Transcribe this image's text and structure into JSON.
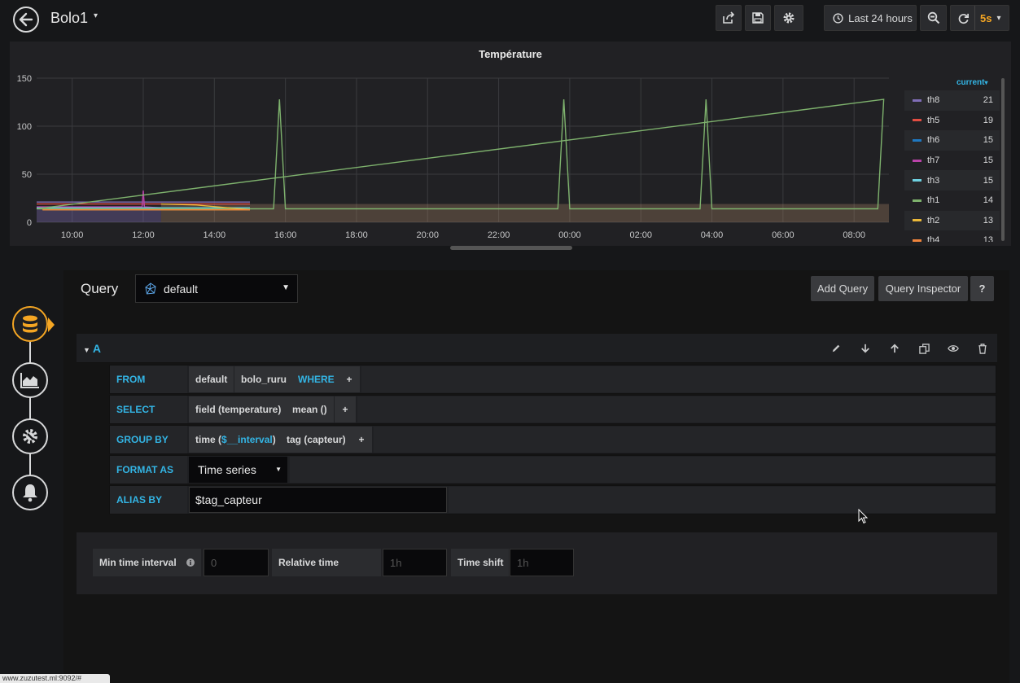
{
  "header": {
    "dashboard_title": "Bolo1",
    "time_range": "Last 24 hours",
    "refresh_interval": "5s"
  },
  "panel": {
    "title": "Température",
    "legend_header": "current",
    "legend": [
      {
        "name": "th8",
        "value": "21",
        "color": "#806eb7"
      },
      {
        "name": "th5",
        "value": "19",
        "color": "#e24d42"
      },
      {
        "name": "th6",
        "value": "15",
        "color": "#1f78c1"
      },
      {
        "name": "th7",
        "value": "15",
        "color": "#ba43a9"
      },
      {
        "name": "th3",
        "value": "15",
        "color": "#6ed0e0"
      },
      {
        "name": "th1",
        "value": "14",
        "color": "#7eb26d"
      },
      {
        "name": "th2",
        "value": "13",
        "color": "#eab839"
      },
      {
        "name": "th4",
        "value": "13",
        "color": "#ef843c"
      }
    ]
  },
  "chart_data": {
    "type": "line",
    "title": "Température",
    "x_ticks": [
      "10:00",
      "12:00",
      "14:00",
      "16:00",
      "18:00",
      "20:00",
      "22:00",
      "00:00",
      "02:00",
      "04:00",
      "06:00",
      "08:00"
    ],
    "y_ticks": [
      "0",
      "50",
      "100",
      "150"
    ],
    "ylim": [
      0,
      150
    ],
    "grid": true,
    "legend_placement": "right",
    "series": [
      {
        "name": "th8",
        "x": [
          "09:00",
          "12:30",
          "13:30",
          "15:00",
          "09:10"
        ],
        "values": [
          21,
          21,
          21,
          21,
          21
        ]
      },
      {
        "name": "th5",
        "x": [
          "09:00",
          "12:30",
          "13:30",
          "15:00",
          "09:10"
        ],
        "values": [
          19,
          19,
          19,
          19,
          19
        ]
      },
      {
        "name": "th6",
        "x": [
          "09:00",
          "12:30",
          "13:30",
          "15:00",
          "09:10"
        ],
        "values": [
          15,
          15,
          15,
          15,
          15
        ]
      },
      {
        "name": "th7",
        "x": [
          "09:00",
          "11:58",
          "12:00",
          "12:02",
          "12:30",
          "09:10"
        ],
        "values": [
          16,
          16,
          33,
          16,
          15,
          15
        ]
      },
      {
        "name": "th3",
        "x": [
          "09:00",
          "12:30",
          "15:00",
          "09:10"
        ],
        "values": [
          15,
          15,
          15,
          15
        ]
      },
      {
        "name": "th1",
        "x": [
          "09:00",
          "15:40",
          "15:50",
          "16:00",
          "23:40",
          "23:50",
          "00:00",
          "03:40",
          "03:50",
          "04:00",
          "08:40",
          "08:50",
          "09:00",
          "09:10"
        ],
        "values": [
          14,
          14,
          128,
          14,
          14,
          128,
          14,
          14,
          128,
          14,
          14,
          128,
          14,
          14
        ]
      },
      {
        "name": "th2",
        "x": [
          "12:30",
          "13:30",
          "15:00",
          "09:10"
        ],
        "values": [
          19,
          18,
          13,
          13
        ]
      },
      {
        "name": "th4",
        "x": [
          "12:30",
          "15:00",
          "09:10"
        ],
        "values": [
          13,
          13,
          13
        ]
      }
    ]
  },
  "query": {
    "label": "Query",
    "datasource": "default",
    "add_query": "Add Query",
    "query_inspector": "Query Inspector",
    "help": "?",
    "ref_id": "A",
    "from_kw": "FROM",
    "from_policy": "default",
    "from_measurement": "bolo_ruru",
    "where_kw": "WHERE",
    "plus": "+",
    "select_kw": "SELECT",
    "select_field": "field (temperature)",
    "select_fn": "mean ()",
    "group_kw": "GROUP BY",
    "group_time_prefix": "time (",
    "group_time_var": "$__interval",
    "group_time_suffix": ")",
    "group_tag": "tag (capteur)",
    "format_kw": "FORMAT AS",
    "format_value": "Time series",
    "alias_kw": "ALIAS BY",
    "alias_value": "$tag_capteur"
  },
  "options": {
    "min_interval_label": "Min time interval",
    "min_interval_placeholder": "0",
    "relative_time_label": "Relative time",
    "relative_time_placeholder": "1h",
    "time_shift_label": "Time shift",
    "time_shift_placeholder": "1h"
  },
  "status_url": "www.zuzutest.ml:9092/#"
}
